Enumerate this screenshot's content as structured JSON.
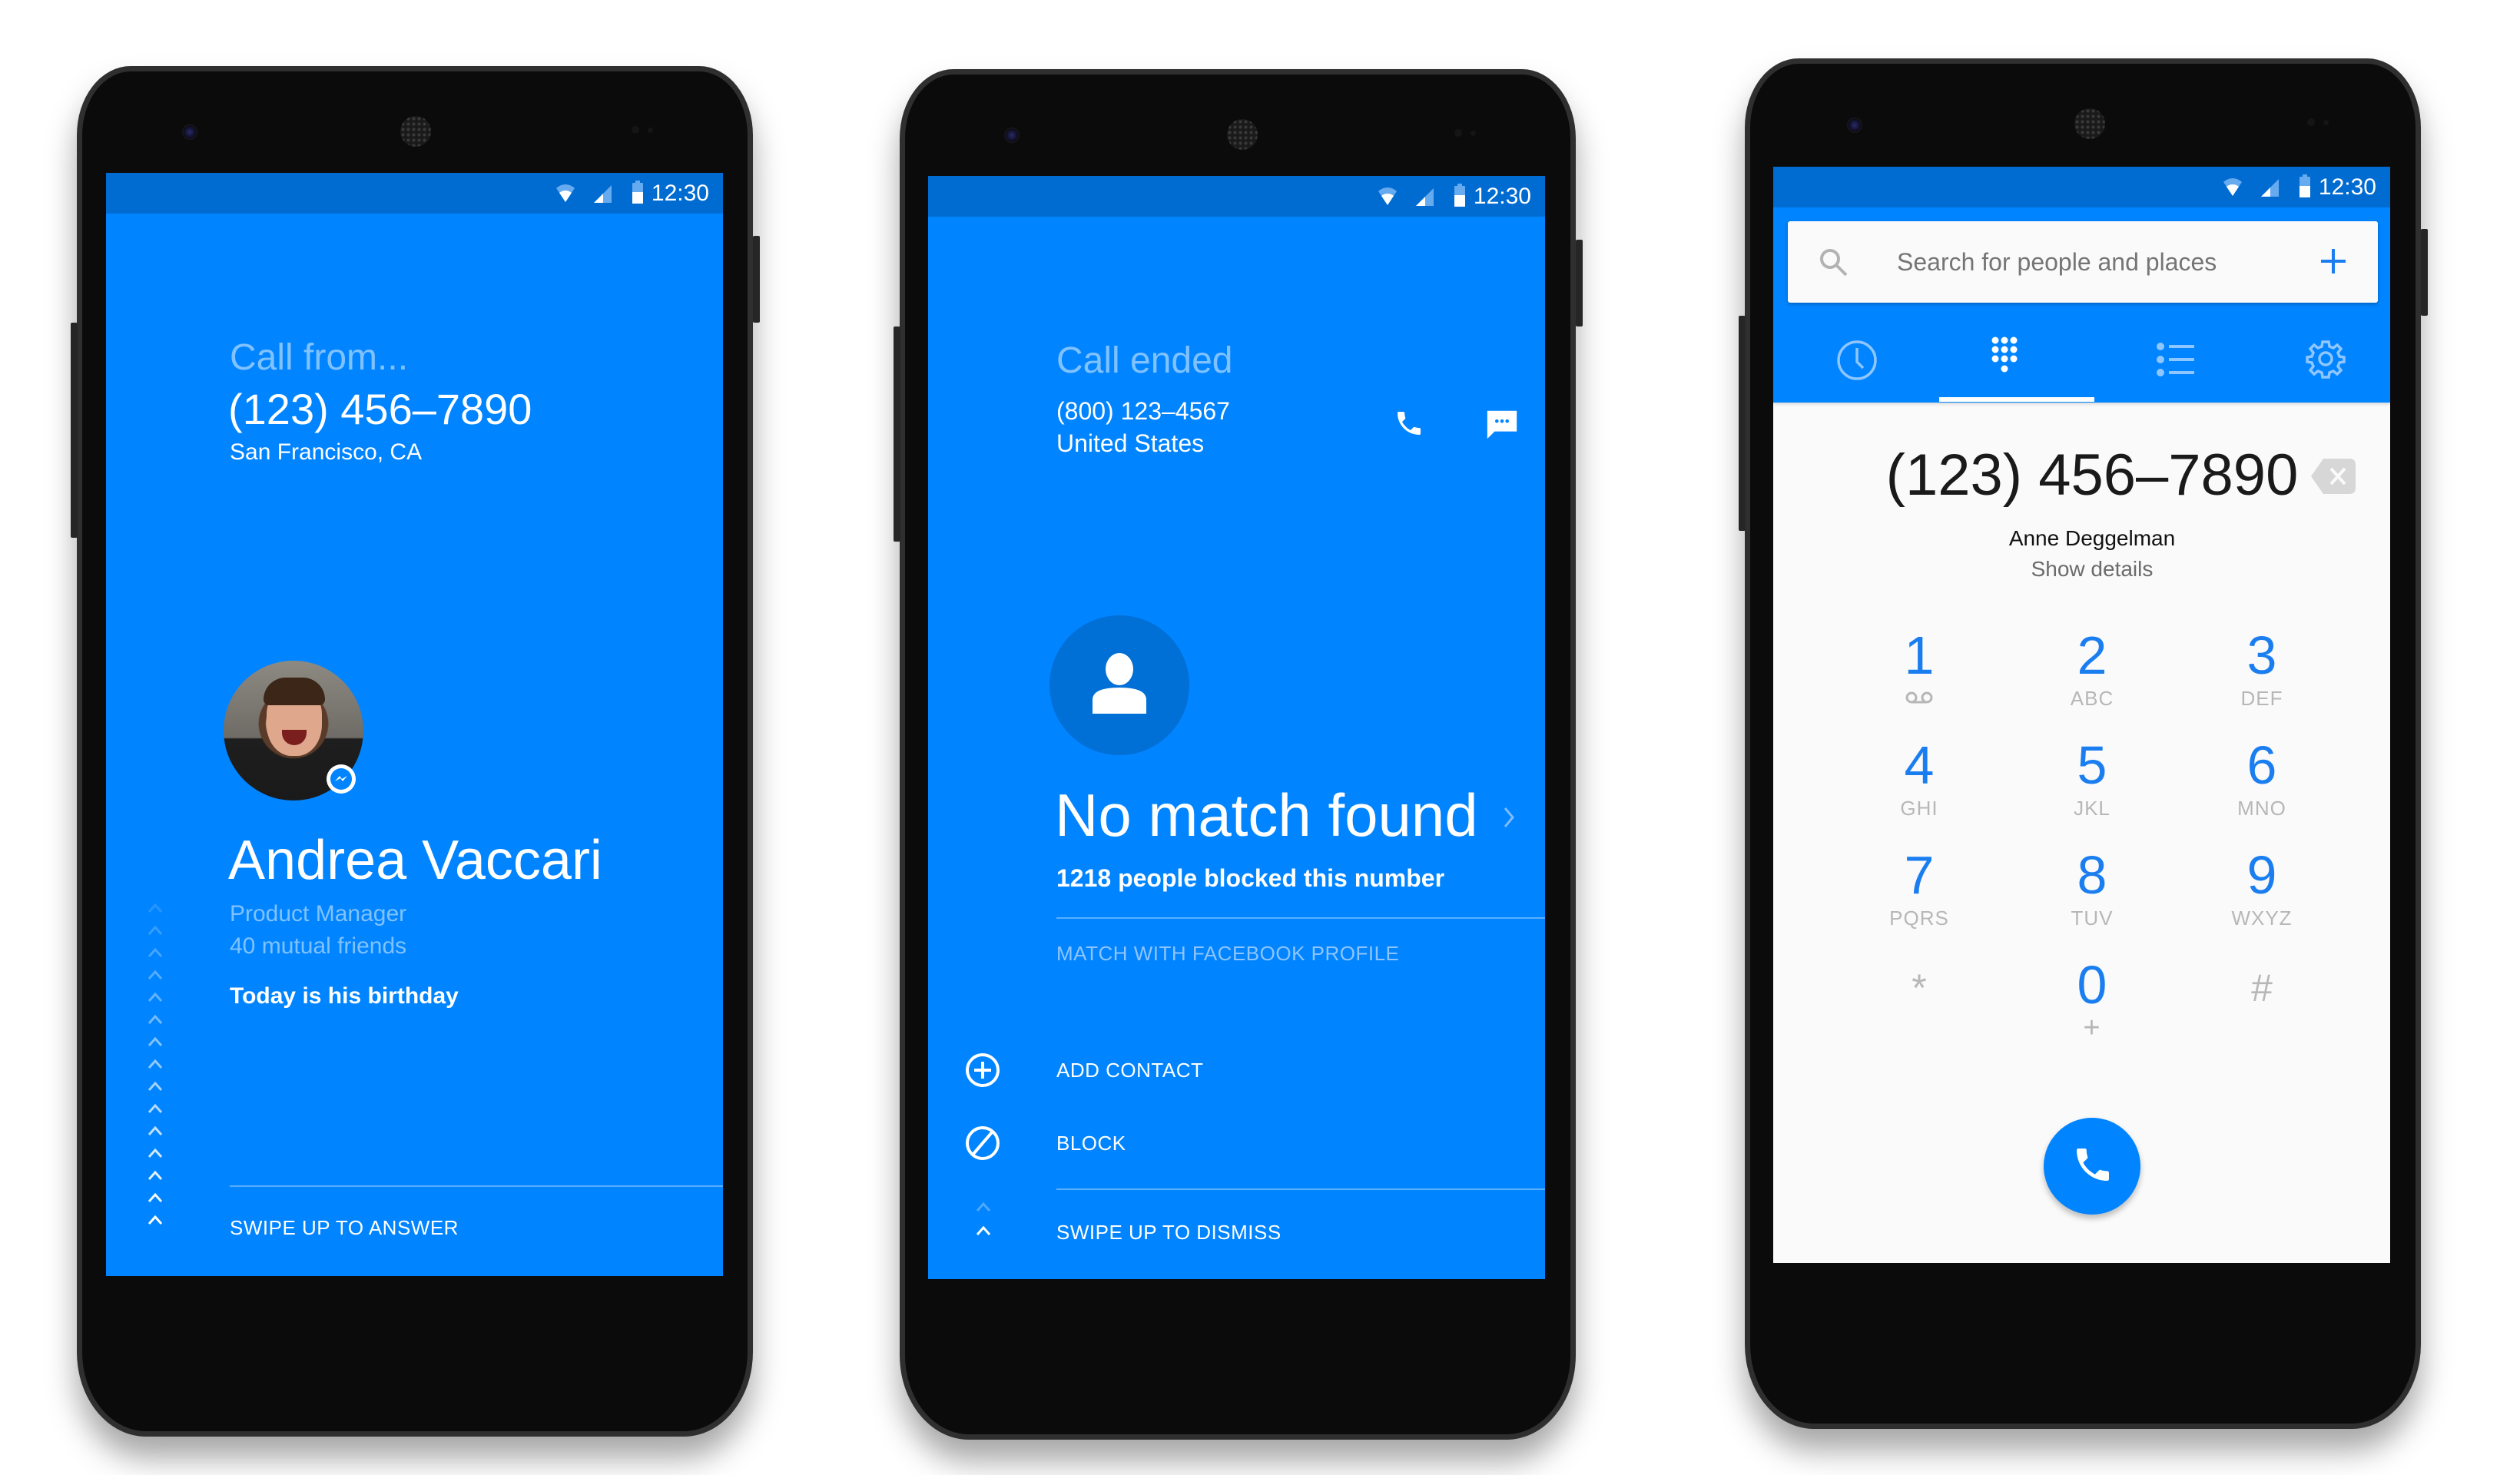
{
  "colors": {
    "brand_blue": "#0084ff",
    "status_bar": "#006bd0",
    "avatar_placeholder": "#006fd6",
    "keypad_digit": "#1a7ef0",
    "keypad_letters": "#b7b7b7",
    "dialer_bg": "#fafafa"
  },
  "status_bar": {
    "time": "12:30",
    "icons": [
      "wifi-icon",
      "cell-signal-icon",
      "battery-icon"
    ]
  },
  "incoming_call": {
    "header": "Call from...",
    "number": "(123) 456–7890",
    "location": "San Francisco, CA",
    "avatar_badge_icon": "messenger-icon",
    "name": "Andrea Vaccari",
    "title": "Product Manager",
    "mutual_friends": "40 mutual friends",
    "birthday_note": "Today is his birthday",
    "swipe_label": "SWIPE UP TO ANSWER",
    "chevron_icon": "chevron-up-icon"
  },
  "call_ended": {
    "header": "Call ended",
    "number": "(800) 123–4567",
    "location": "United States",
    "actions_icons": [
      "phone-icon",
      "message-icon"
    ],
    "avatar_icon": "person-icon",
    "title": "No match found",
    "blocked_count_text": "1218 people blocked this number",
    "match_link": "MATCH WITH FACEBOOK PROFILE",
    "menu": [
      {
        "icon": "add-circle-icon",
        "label": "ADD CONTACT"
      },
      {
        "icon": "block-icon",
        "label": "BLOCK"
      }
    ],
    "swipe_label": "SWIPE UP TO DISMISS"
  },
  "dialer": {
    "search_placeholder": "Search for people and places",
    "tabs": [
      {
        "icon": "clock-icon",
        "name": "recents",
        "active": false
      },
      {
        "icon": "dialpad-icon",
        "name": "dialpad",
        "active": true
      },
      {
        "icon": "list-icon",
        "name": "contacts",
        "active": false
      },
      {
        "icon": "gear-icon",
        "name": "settings",
        "active": false
      }
    ],
    "entered_number": "(123) 456–7890",
    "contact_name": "Anne Deggelman",
    "show_details": "Show details",
    "keys": [
      {
        "digit": "1",
        "letters": "voicemail-icon"
      },
      {
        "digit": "2",
        "letters": "ABC"
      },
      {
        "digit": "3",
        "letters": "DEF"
      },
      {
        "digit": "4",
        "letters": "GHI"
      },
      {
        "digit": "5",
        "letters": "JKL"
      },
      {
        "digit": "6",
        "letters": "MNO"
      },
      {
        "digit": "7",
        "letters": "PQRS"
      },
      {
        "digit": "8",
        "letters": "TUV"
      },
      {
        "digit": "9",
        "letters": "WXYZ"
      },
      {
        "digit": "*",
        "letters": ""
      },
      {
        "digit": "0",
        "letters": "+"
      },
      {
        "digit": "#",
        "letters": ""
      }
    ]
  }
}
